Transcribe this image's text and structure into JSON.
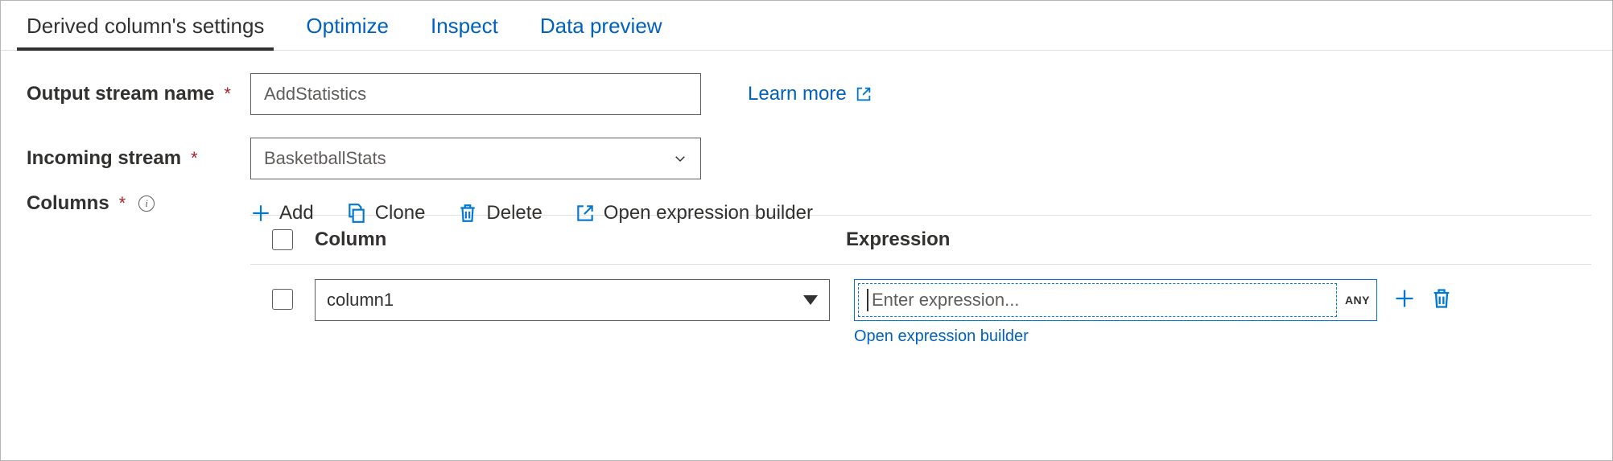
{
  "tabs": {
    "settings": "Derived column's settings",
    "optimize": "Optimize",
    "inspect": "Inspect",
    "preview": "Data preview"
  },
  "labels": {
    "output_stream": "Output stream name",
    "incoming_stream": "Incoming stream",
    "columns": "Columns"
  },
  "values": {
    "output_stream": "AddStatistics",
    "incoming_stream": "BasketballStats"
  },
  "learn_more": "Learn more",
  "toolbar": {
    "add": "Add",
    "clone": "Clone",
    "delete": "Delete",
    "open_builder": "Open expression builder"
  },
  "grid": {
    "col_column": "Column",
    "col_expression": "Expression",
    "row1_column": "column1",
    "row1_expr_placeholder": "Enter expression...",
    "any_badge": "ANY",
    "open_builder_link": "Open expression builder"
  }
}
